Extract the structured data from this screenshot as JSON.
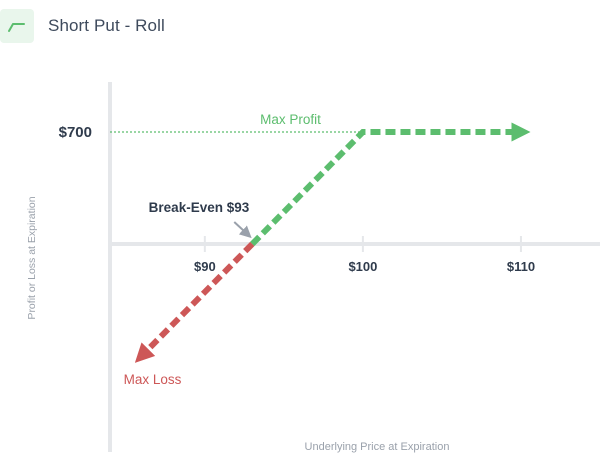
{
  "header": {
    "title": "Short Put - Roll",
    "icon": "payoff-line-icon"
  },
  "colors": {
    "profit": "#5cbd6e",
    "loss": "#cd5757",
    "axis": "#e5e7ea",
    "text": "#2f3b4c",
    "muted": "#9aa1ab"
  },
  "chart_data": {
    "type": "line",
    "title": "",
    "xlabel": "Underlying Price at Expiration",
    "ylabel": "Profit or Loss at Expiration",
    "xlim": [
      84,
      115
    ],
    "ylim": [
      -1300,
      1200
    ],
    "x_ticks": [
      {
        "value": 90,
        "label": "$90"
      },
      {
        "value": 100,
        "label": "$100"
      },
      {
        "value": 110,
        "label": "$110"
      }
    ],
    "y_ticks": [
      {
        "value": 700,
        "label": "$700"
      }
    ],
    "series": [
      {
        "role": "profit",
        "points": [
          [
            93,
            0
          ],
          [
            100,
            700
          ],
          [
            110,
            700
          ]
        ]
      },
      {
        "role": "loss",
        "points": [
          [
            93,
            0
          ],
          [
            86,
            -700
          ]
        ]
      }
    ],
    "annotations": {
      "max_profit": {
        "text": "Max Profit",
        "y": 700
      },
      "max_loss": {
        "text": "Max Loss"
      },
      "break_even": {
        "text": "Break-Even $93",
        "x": 93
      }
    }
  }
}
